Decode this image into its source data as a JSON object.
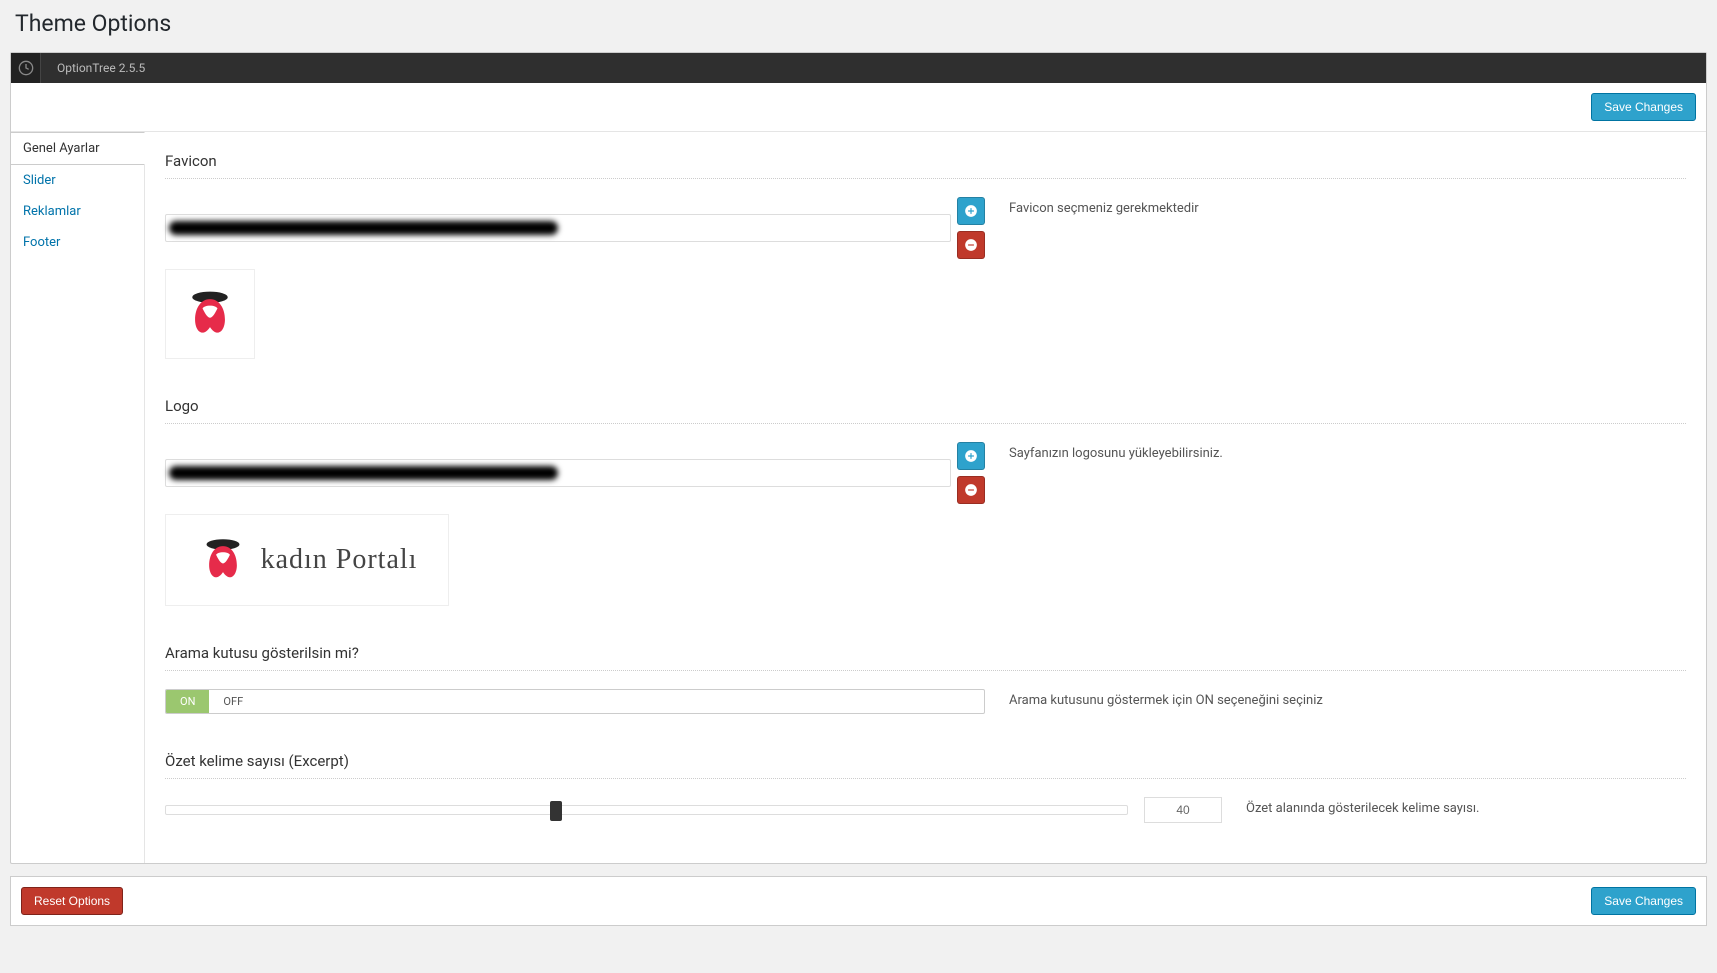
{
  "page_title": "Theme Options",
  "header": {
    "brand": "OptionTree 2.5.5"
  },
  "buttons": {
    "save": "Save Changes",
    "reset": "Reset Options"
  },
  "nav": {
    "items": [
      {
        "label": "Genel Ayarlar",
        "active": true
      },
      {
        "label": "Slider",
        "active": false
      },
      {
        "label": "Reklamlar",
        "active": false
      },
      {
        "label": "Footer",
        "active": false
      }
    ]
  },
  "sections": {
    "favicon": {
      "title": "Favicon",
      "desc": "Favicon seçmeniz gerekmektedir",
      "value": ""
    },
    "logo": {
      "title": "Logo",
      "desc": "Sayfanızın logosunu yükleyebilirsiniz.",
      "brand_text": "kadın Portalı",
      "value": ""
    },
    "searchbox": {
      "title": "Arama kutusu gösterilsin mi?",
      "desc": "Arama kutusunu göstermek için ON seçeneğini seçiniz",
      "on": "ON",
      "off": "OFF",
      "value": "ON"
    },
    "excerpt": {
      "title": "Özet kelime sayısı (Excerpt)",
      "desc": "Özet alanında gösterilecek kelime sayısı.",
      "value": "40"
    }
  }
}
